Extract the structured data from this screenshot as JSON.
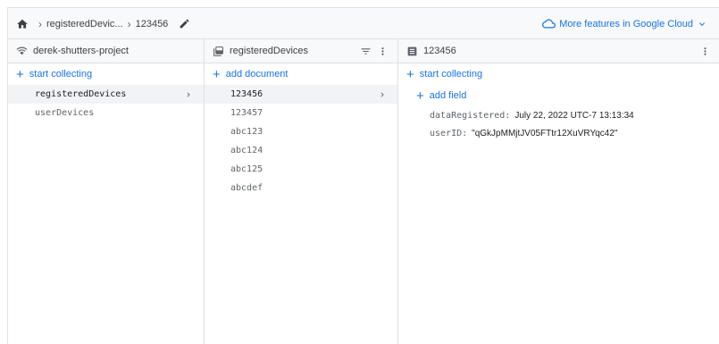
{
  "breadcrumb": {
    "home_icon": "home-icon",
    "items": [
      "registeredDevic...",
      "123456"
    ],
    "edit_icon": "pencil-icon"
  },
  "header": {
    "cloud_link": "More features in Google Cloud",
    "accent": "#1a73e8"
  },
  "col_root": {
    "title": "derek-shutters-project",
    "action": "start collecting",
    "items": [
      "registeredDevices",
      "userDevices"
    ],
    "selected": 0
  },
  "col_collection": {
    "title": "registeredDevices",
    "action": "add document",
    "items": [
      "123456",
      "123457",
      "abc123",
      "abc124",
      "abc125",
      "abcdef"
    ],
    "selected": 0
  },
  "col_document": {
    "title": "123456",
    "action_collection": "start collecting",
    "action_field": "add field",
    "fields": [
      {
        "key": "dataRegistered",
        "value": "July 22, 2022 UTC-7 13:13:34"
      },
      {
        "key": "userID",
        "value": "\"qGkJpMMjtJV05FTtr12XuVRYqc42\""
      }
    ]
  }
}
